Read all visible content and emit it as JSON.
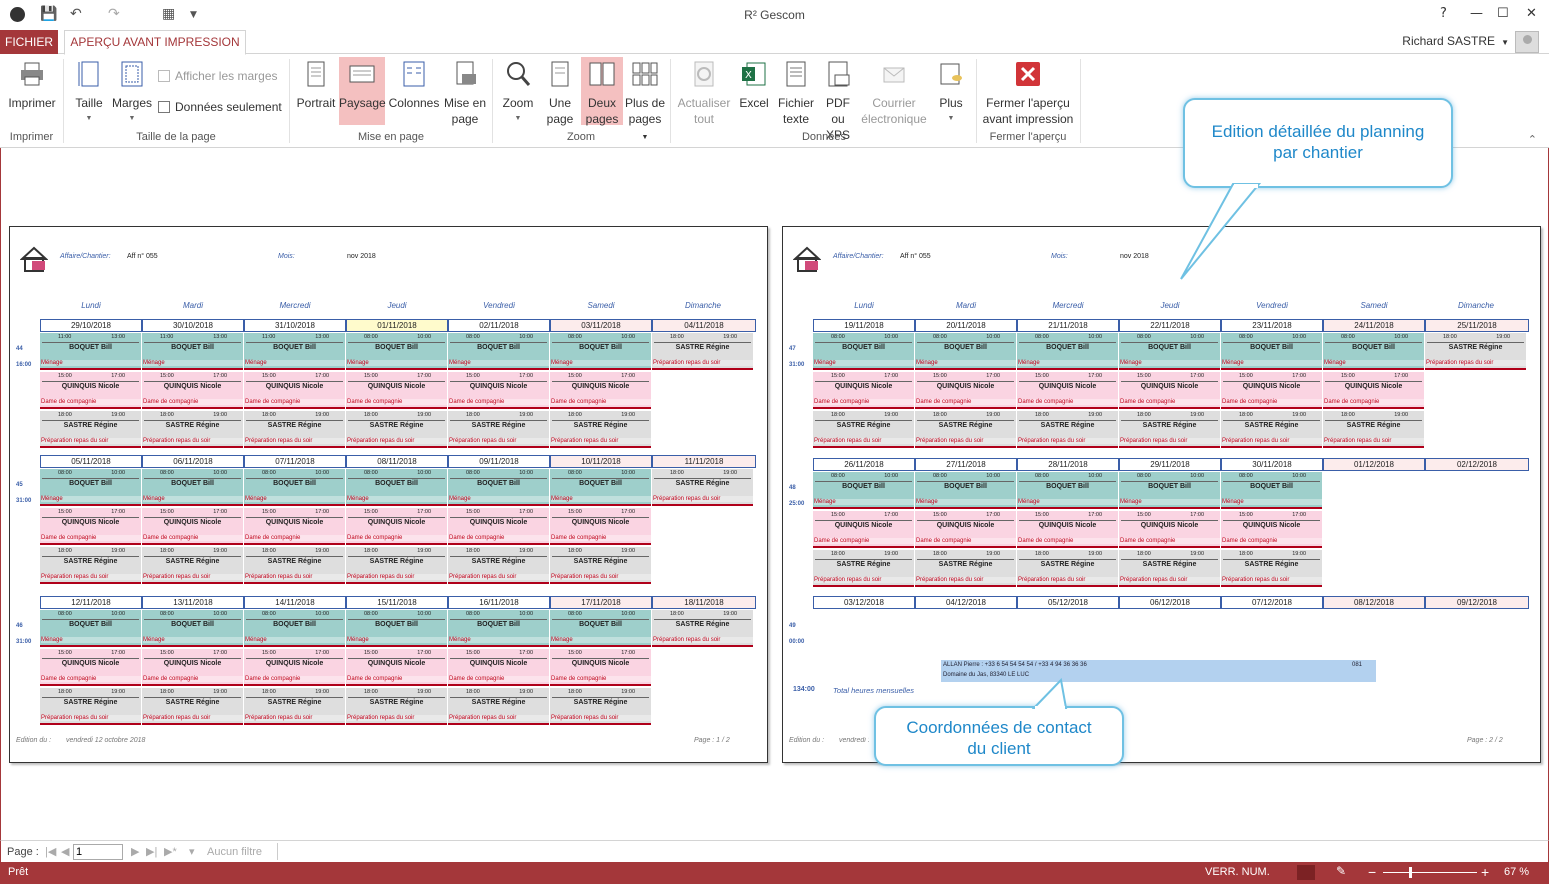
{
  "window": {
    "title": "R² Gescom",
    "help": "?",
    "minimize": "—",
    "restore": "☐",
    "close": "✕"
  },
  "tabs": {
    "file": "FICHIER",
    "active": "APERÇU AVANT IMPRESSION"
  },
  "user": {
    "name": "Richard SASTRE"
  },
  "ribbon": {
    "print": "Imprimer",
    "size": "Taille",
    "margins": "Marges",
    "show_margins": "Afficher les marges",
    "data_only": "Données seulement",
    "portrait": "Portrait",
    "landscape": "Paysage",
    "columns": "Colonnes",
    "page_setup_l1": "Mise en",
    "page_setup_l2": "page",
    "zoom": "Zoom",
    "one_page_l1": "Une",
    "one_page_l2": "page",
    "two_pages_l1": "Deux",
    "two_pages_l2": "pages",
    "more_pages_l1": "Plus de",
    "more_pages_l2": "pages",
    "refresh_l1": "Actualiser",
    "refresh_l2": "tout",
    "excel": "Excel",
    "text_file_l1": "Fichier",
    "text_file_l2": "texte",
    "pdf_l1": "PDF",
    "pdf_l2": "ou XPS",
    "email_l1": "Courrier",
    "email_l2": "électronique",
    "more": "Plus",
    "close_preview_l1": "Fermer l'aperçu",
    "close_preview_l2": "avant impression",
    "groups": {
      "print": "Imprimer",
      "page_size": "Taille de la page",
      "layout": "Mise en page",
      "zoom": "Zoom",
      "data": "Données",
      "close": "Fermer l'aperçu"
    }
  },
  "report": {
    "label_affaire": "Affaire/Chantier:",
    "affaire": "Aff n° 055",
    "label_mois": "Mois:",
    "mois": "nov 2018",
    "weekdays": [
      "Lundi",
      "Mardi",
      "Mercredi",
      "Jeudi",
      "Vendredi",
      "Samedi",
      "Dimanche"
    ],
    "edition_label": "Edition du :",
    "edition_date": "vendredi 12 octobre 2018",
    "page1": "Page : 1 / 2",
    "page2": "Page : 2 / 2",
    "total_hours": "134:00",
    "total_label": "Total heures mensuelles",
    "contact_line1": "ALLAN Pierre : +33 6 54 54 54 54 / +33 4 94 36 36 36",
    "contact_code": "081",
    "contact_line2": "Domaine du Jas, 83340 LE LUC",
    "names": {
      "bill": "BOQUET Bill",
      "nicole": "QUINQUIS Nicole",
      "regine": "SASTRE Régine"
    },
    "tasks": {
      "menage": "Ménage",
      "dame": "Dame de compagnie",
      "repas": "Préparation repas du soir"
    },
    "times": {
      "m1": "08:00",
      "m2": "10:00",
      "a1": "15:00",
      "a2": "17:00",
      "e1": "18:00",
      "e2": "19:00",
      "s1": "11:00",
      "s2": "13:00"
    },
    "page1_weeks": [
      {
        "num": "44",
        "hours": "16:00",
        "dates": [
          "29/10/2018",
          "30/10/2018",
          "31/10/2018",
          "01/11/2018",
          "02/11/2018",
          "03/11/2018",
          "04/11/2018"
        ]
      },
      {
        "num": "45",
        "hours": "31:00",
        "dates": [
          "05/11/2018",
          "06/11/2018",
          "07/11/2018",
          "08/11/2018",
          "09/11/2018",
          "10/11/2018",
          "11/11/2018"
        ]
      },
      {
        "num": "46",
        "hours": "31:00",
        "dates": [
          "12/11/2018",
          "13/11/2018",
          "14/11/2018",
          "15/11/2018",
          "16/11/2018",
          "17/11/2018",
          "18/11/2018"
        ]
      }
    ],
    "page2_weeks": [
      {
        "num": "47",
        "hours": "31:00",
        "dates": [
          "19/11/2018",
          "20/11/2018",
          "21/11/2018",
          "22/11/2018",
          "23/11/2018",
          "24/11/2018",
          "25/11/2018"
        ]
      },
      {
        "num": "48",
        "hours": "25:00",
        "dates": [
          "26/11/2018",
          "27/11/2018",
          "28/11/2018",
          "29/11/2018",
          "30/11/2018",
          "01/12/2018",
          "02/12/2018"
        ]
      },
      {
        "num": "49",
        "hours": "00:00",
        "dates": [
          "03/12/2018",
          "04/12/2018",
          "05/12/2018",
          "06/12/2018",
          "07/12/2018",
          "08/12/2018",
          "09/12/2018"
        ]
      }
    ]
  },
  "callouts": {
    "planning_l1": "Edition détaillée du planning",
    "planning_l2": "par chantier",
    "contact_l1": "Coordonnées de contact",
    "contact_l2": "du client"
  },
  "nav": {
    "page_label": "Page :",
    "page_value": "1",
    "filter": "Aucun filtre"
  },
  "status": {
    "ready": "Prêt",
    "numlock": "VERR. NUM.",
    "zoom": "67 %"
  },
  "colors": {
    "accent": "#a4373a",
    "callout": "#1f88c9",
    "teal": "#9ecfcb",
    "pink": "#fad4e2",
    "grey": "#dedede"
  }
}
